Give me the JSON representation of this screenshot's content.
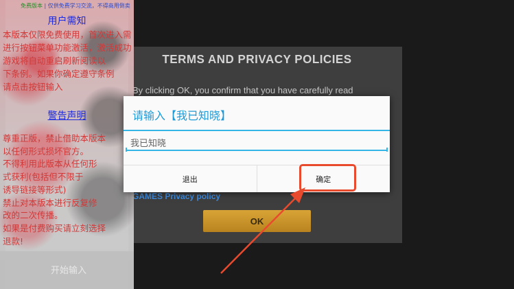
{
  "terms_panel": {
    "title": "TERMS AND PRIVACY POLICIES",
    "body_text": "By clicking OK, you confirm that you have carefully read",
    "link_text": "GAMES Privacy policy",
    "ok_label": "OK"
  },
  "notice_panel": {
    "tagline_green": "免费版本",
    "tagline_blue": "| 仅供免费学习交流，不得商用倒卖",
    "heading": "用户需知",
    "paragraph_1": [
      "本版本仅限免费使用，首次进入需",
      "进行按钮菜单功能激活，激活成功",
      "游戏将自动重启刷新阅读以",
      "下条例。如果你确定遵守条例",
      "请点击按钮输入"
    ],
    "heading_2": "警告声明",
    "paragraph_2": [
      "尊重正版，禁止借助本版本",
      "以任何形式损坏官方。",
      "不得利用此版本从任何形",
      "式获利(包括但不限于",
      "诱导链接等形式)",
      "禁止对本版本进行反复修",
      "改的二次传播。",
      "如果是付费购买请立刻选择",
      "退款!"
    ],
    "start_label": "开始输入"
  },
  "dialog": {
    "title": "请输入【我已知晓】",
    "input_value": "我已知晓",
    "cancel_label": "退出",
    "confirm_label": "确定"
  },
  "colors": {
    "dialog_accent": "#33b5e5",
    "dialog_title": "#1e9ad6",
    "annotation": "#e84a2e",
    "ok_button": "#d9a436"
  }
}
